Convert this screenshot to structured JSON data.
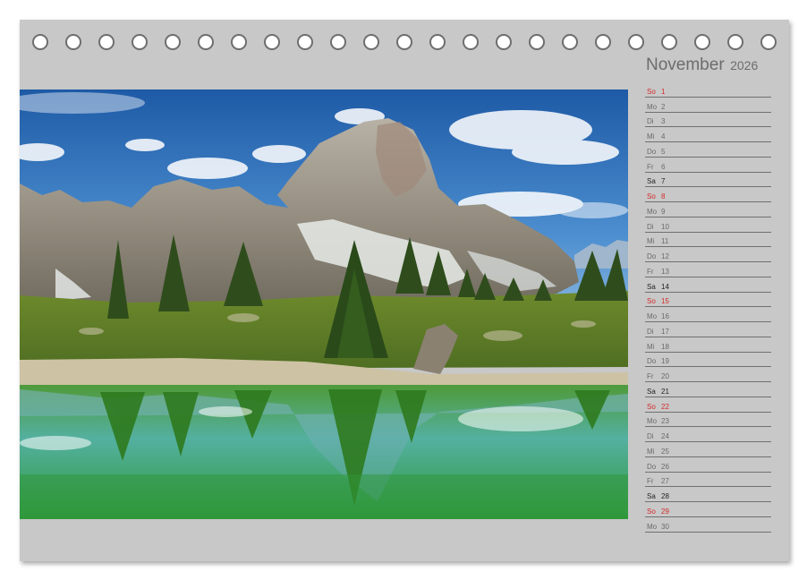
{
  "calendar": {
    "month": "November",
    "year": "2026",
    "days": [
      {
        "wd": "So",
        "d": "1",
        "type": "sun"
      },
      {
        "wd": "Mo",
        "d": "2",
        "type": "week"
      },
      {
        "wd": "Di",
        "d": "3",
        "type": "week"
      },
      {
        "wd": "Mi",
        "d": "4",
        "type": "week"
      },
      {
        "wd": "Do",
        "d": "5",
        "type": "week"
      },
      {
        "wd": "Fr",
        "d": "6",
        "type": "week"
      },
      {
        "wd": "Sa",
        "d": "7",
        "type": "sat"
      },
      {
        "wd": "So",
        "d": "8",
        "type": "sun"
      },
      {
        "wd": "Mo",
        "d": "9",
        "type": "week"
      },
      {
        "wd": "Di",
        "d": "10",
        "type": "week"
      },
      {
        "wd": "Mi",
        "d": "11",
        "type": "week"
      },
      {
        "wd": "Do",
        "d": "12",
        "type": "week"
      },
      {
        "wd": "Fr",
        "d": "13",
        "type": "week"
      },
      {
        "wd": "Sa",
        "d": "14",
        "type": "sat"
      },
      {
        "wd": "So",
        "d": "15",
        "type": "sun"
      },
      {
        "wd": "Mo",
        "d": "16",
        "type": "week"
      },
      {
        "wd": "Di",
        "d": "17",
        "type": "week"
      },
      {
        "wd": "Mi",
        "d": "18",
        "type": "week"
      },
      {
        "wd": "Do",
        "d": "19",
        "type": "week"
      },
      {
        "wd": "Fr",
        "d": "20",
        "type": "week"
      },
      {
        "wd": "Sa",
        "d": "21",
        "type": "sat"
      },
      {
        "wd": "So",
        "d": "22",
        "type": "sun"
      },
      {
        "wd": "Mo",
        "d": "23",
        "type": "week"
      },
      {
        "wd": "Di",
        "d": "24",
        "type": "week"
      },
      {
        "wd": "Mi",
        "d": "25",
        "type": "week"
      },
      {
        "wd": "Do",
        "d": "26",
        "type": "week"
      },
      {
        "wd": "Fr",
        "d": "27",
        "type": "week"
      },
      {
        "wd": "Sa",
        "d": "28",
        "type": "sat"
      },
      {
        "wd": "So",
        "d": "29",
        "type": "sun"
      },
      {
        "wd": "Mo",
        "d": "30",
        "type": "week"
      }
    ]
  },
  "colors": {
    "page_background": "#c8c8c8",
    "sunday": "#d42a2a",
    "saturday": "#222222",
    "weekday": "#6a6a6a",
    "ring": "#6e6e6e"
  },
  "binding": {
    "ring_count": 23
  }
}
